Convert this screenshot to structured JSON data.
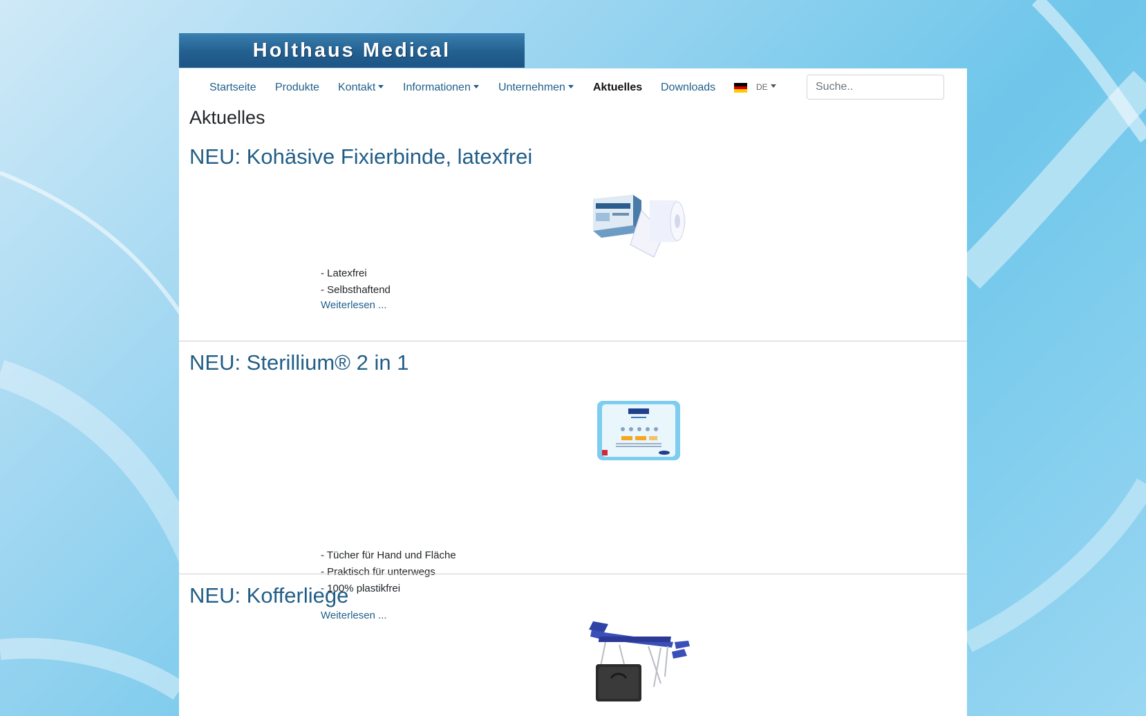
{
  "logo": {
    "text": "Holthaus Medical"
  },
  "nav": {
    "items": [
      {
        "label": "Startseite",
        "dropdown": false,
        "active": false
      },
      {
        "label": "Produkte",
        "dropdown": false,
        "active": false
      },
      {
        "label": "Kontakt",
        "dropdown": true,
        "active": false
      },
      {
        "label": "Informationen",
        "dropdown": true,
        "active": false
      },
      {
        "label": "Unternehmen",
        "dropdown": true,
        "active": false
      },
      {
        "label": "Aktuelles",
        "dropdown": false,
        "active": true
      },
      {
        "label": "Downloads",
        "dropdown": false,
        "active": false
      }
    ],
    "language": {
      "code": "DE",
      "flag_icon": "germany-flag-icon",
      "flag_colors": [
        "#000000",
        "#dd0000",
        "#ffcc00"
      ]
    },
    "search": {
      "placeholder": "Suche..",
      "value": ""
    }
  },
  "page": {
    "heading": "Aktuelles"
  },
  "articles": [
    {
      "title": "NEU: Kohäsive Fixierbinde, latexfrei",
      "image_icon": "fixation-bandage-product-image",
      "bullets": [
        "- Latexfrei",
        "- Selbsthaftend"
      ],
      "read_more": "Weiterlesen ..."
    },
    {
      "title": "NEU: Sterillium® 2 in 1",
      "image_icon": "sterillium-wipes-product-image",
      "bullets": [
        "- Tücher für Hand und Fläche",
        "- Praktisch für unterwegs",
        "- 100% plastikfrei"
      ],
      "read_more": "Weiterlesen ..."
    },
    {
      "title": "NEU: Kofferliege",
      "image_icon": "portable-massage-table-product-image",
      "bullets": [],
      "read_more": ""
    }
  ],
  "colors": {
    "brand": "#215e87",
    "link": "#1f5f8b",
    "logo_bg": "#235f8f"
  }
}
